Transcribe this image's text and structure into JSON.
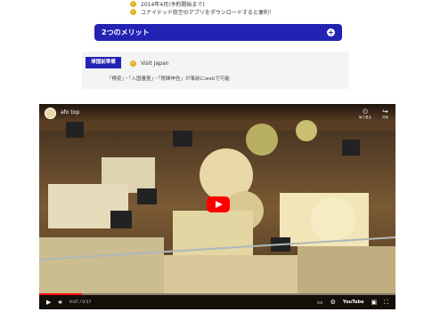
{
  "top_bullets": [
    "2014年4月(予約開始まで)",
    "ユナイテッド航空のアプリをダウンロードすると便利！"
  ],
  "merit": {
    "title": "2つのメリット",
    "icon": "plus-icon"
  },
  "section": {
    "tag": "帰国前準備",
    "item": "Visit Japan",
    "note": "「検疫」・「入国審査」・「税関申告」が事前にwebで可能"
  },
  "video": {
    "title": "afo top",
    "top_actions": [
      {
        "icon": "clock-icon",
        "label": "後で見る"
      },
      {
        "icon": "share-icon",
        "label": "共有"
      }
    ],
    "time": "0:07 / 0:57",
    "progress": 0.12,
    "logo": "YouTube",
    "colors": {
      "play": "#ff0000",
      "accent": "#2323b3"
    }
  }
}
